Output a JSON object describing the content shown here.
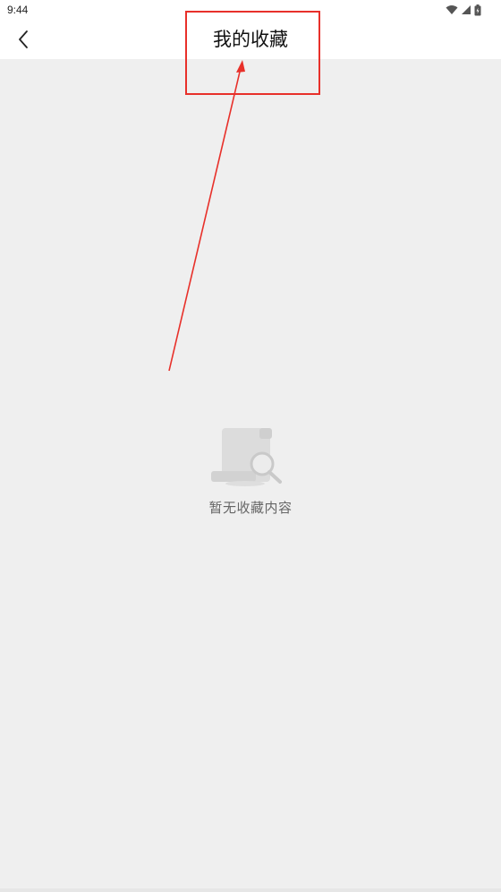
{
  "status_bar": {
    "time": "9:44",
    "icons": [
      "wifi-icon",
      "cellular-signal-icon",
      "battery-icon"
    ]
  },
  "app_bar": {
    "back_icon": "chevron-left-icon",
    "title": "我的收藏"
  },
  "empty_state": {
    "illustration": "document-search-icon",
    "message": "暂无收藏内容"
  },
  "annotation": {
    "color": "#e8302a"
  },
  "colors": {
    "background": "#efefef",
    "header": "#ffffff",
    "title_text": "#111111",
    "empty_text": "#666666"
  }
}
